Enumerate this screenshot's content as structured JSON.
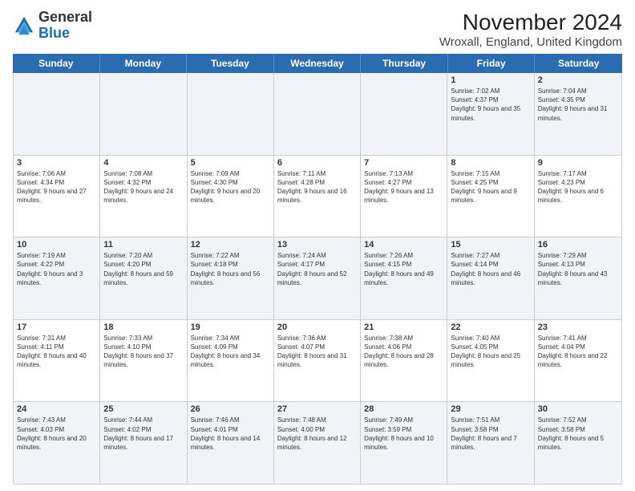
{
  "logo": {
    "text_general": "General",
    "text_blue": "Blue"
  },
  "header": {
    "title": "November 2024",
    "subtitle": "Wroxall, England, United Kingdom"
  },
  "weekdays": [
    "Sunday",
    "Monday",
    "Tuesday",
    "Wednesday",
    "Thursday",
    "Friday",
    "Saturday"
  ],
  "weeks": [
    [
      {
        "day": "",
        "info": ""
      },
      {
        "day": "",
        "info": ""
      },
      {
        "day": "",
        "info": ""
      },
      {
        "day": "",
        "info": ""
      },
      {
        "day": "",
        "info": ""
      },
      {
        "day": "1",
        "info": "Sunrise: 7:02 AM\nSunset: 4:37 PM\nDaylight: 9 hours and 35 minutes."
      },
      {
        "day": "2",
        "info": "Sunrise: 7:04 AM\nSunset: 4:35 PM\nDaylight: 9 hours and 31 minutes."
      }
    ],
    [
      {
        "day": "3",
        "info": "Sunrise: 7:06 AM\nSunset: 4:34 PM\nDaylight: 9 hours and 27 minutes."
      },
      {
        "day": "4",
        "info": "Sunrise: 7:08 AM\nSunset: 4:32 PM\nDaylight: 9 hours and 24 minutes."
      },
      {
        "day": "5",
        "info": "Sunrise: 7:09 AM\nSunset: 4:30 PM\nDaylight: 9 hours and 20 minutes."
      },
      {
        "day": "6",
        "info": "Sunrise: 7:11 AM\nSunset: 4:28 PM\nDaylight: 9 hours and 16 minutes."
      },
      {
        "day": "7",
        "info": "Sunrise: 7:13 AM\nSunset: 4:27 PM\nDaylight: 9 hours and 13 minutes."
      },
      {
        "day": "8",
        "info": "Sunrise: 7:15 AM\nSunset: 4:25 PM\nDaylight: 9 hours and 9 minutes."
      },
      {
        "day": "9",
        "info": "Sunrise: 7:17 AM\nSunset: 4:23 PM\nDaylight: 9 hours and 6 minutes."
      }
    ],
    [
      {
        "day": "10",
        "info": "Sunrise: 7:19 AM\nSunset: 4:22 PM\nDaylight: 9 hours and 3 minutes."
      },
      {
        "day": "11",
        "info": "Sunrise: 7:20 AM\nSunset: 4:20 PM\nDaylight: 8 hours and 59 minutes."
      },
      {
        "day": "12",
        "info": "Sunrise: 7:22 AM\nSunset: 4:18 PM\nDaylight: 8 hours and 56 minutes."
      },
      {
        "day": "13",
        "info": "Sunrise: 7:24 AM\nSunset: 4:17 PM\nDaylight: 8 hours and 52 minutes."
      },
      {
        "day": "14",
        "info": "Sunrise: 7:26 AM\nSunset: 4:15 PM\nDaylight: 8 hours and 49 minutes."
      },
      {
        "day": "15",
        "info": "Sunrise: 7:27 AM\nSunset: 4:14 PM\nDaylight: 8 hours and 46 minutes."
      },
      {
        "day": "16",
        "info": "Sunrise: 7:29 AM\nSunset: 4:13 PM\nDaylight: 8 hours and 43 minutes."
      }
    ],
    [
      {
        "day": "17",
        "info": "Sunrise: 7:31 AM\nSunset: 4:11 PM\nDaylight: 8 hours and 40 minutes."
      },
      {
        "day": "18",
        "info": "Sunrise: 7:33 AM\nSunset: 4:10 PM\nDaylight: 8 hours and 37 minutes."
      },
      {
        "day": "19",
        "info": "Sunrise: 7:34 AM\nSunset: 4:09 PM\nDaylight: 8 hours and 34 minutes."
      },
      {
        "day": "20",
        "info": "Sunrise: 7:36 AM\nSunset: 4:07 PM\nDaylight: 8 hours and 31 minutes."
      },
      {
        "day": "21",
        "info": "Sunrise: 7:38 AM\nSunset: 4:06 PM\nDaylight: 8 hours and 28 minutes."
      },
      {
        "day": "22",
        "info": "Sunrise: 7:40 AM\nSunset: 4:05 PM\nDaylight: 8 hours and 25 minutes."
      },
      {
        "day": "23",
        "info": "Sunrise: 7:41 AM\nSunset: 4:04 PM\nDaylight: 8 hours and 22 minutes."
      }
    ],
    [
      {
        "day": "24",
        "info": "Sunrise: 7:43 AM\nSunset: 4:03 PM\nDaylight: 8 hours and 20 minutes."
      },
      {
        "day": "25",
        "info": "Sunrise: 7:44 AM\nSunset: 4:02 PM\nDaylight: 8 hours and 17 minutes."
      },
      {
        "day": "26",
        "info": "Sunrise: 7:46 AM\nSunset: 4:01 PM\nDaylight: 8 hours and 14 minutes."
      },
      {
        "day": "27",
        "info": "Sunrise: 7:48 AM\nSunset: 4:00 PM\nDaylight: 8 hours and 12 minutes."
      },
      {
        "day": "28",
        "info": "Sunrise: 7:49 AM\nSunset: 3:59 PM\nDaylight: 8 hours and 10 minutes."
      },
      {
        "day": "29",
        "info": "Sunrise: 7:51 AM\nSunset: 3:58 PM\nDaylight: 8 hours and 7 minutes."
      },
      {
        "day": "30",
        "info": "Sunrise: 7:52 AM\nSunset: 3:58 PM\nDaylight: 8 hours and 5 minutes."
      }
    ]
  ],
  "alt_rows": [
    0,
    2,
    4
  ]
}
